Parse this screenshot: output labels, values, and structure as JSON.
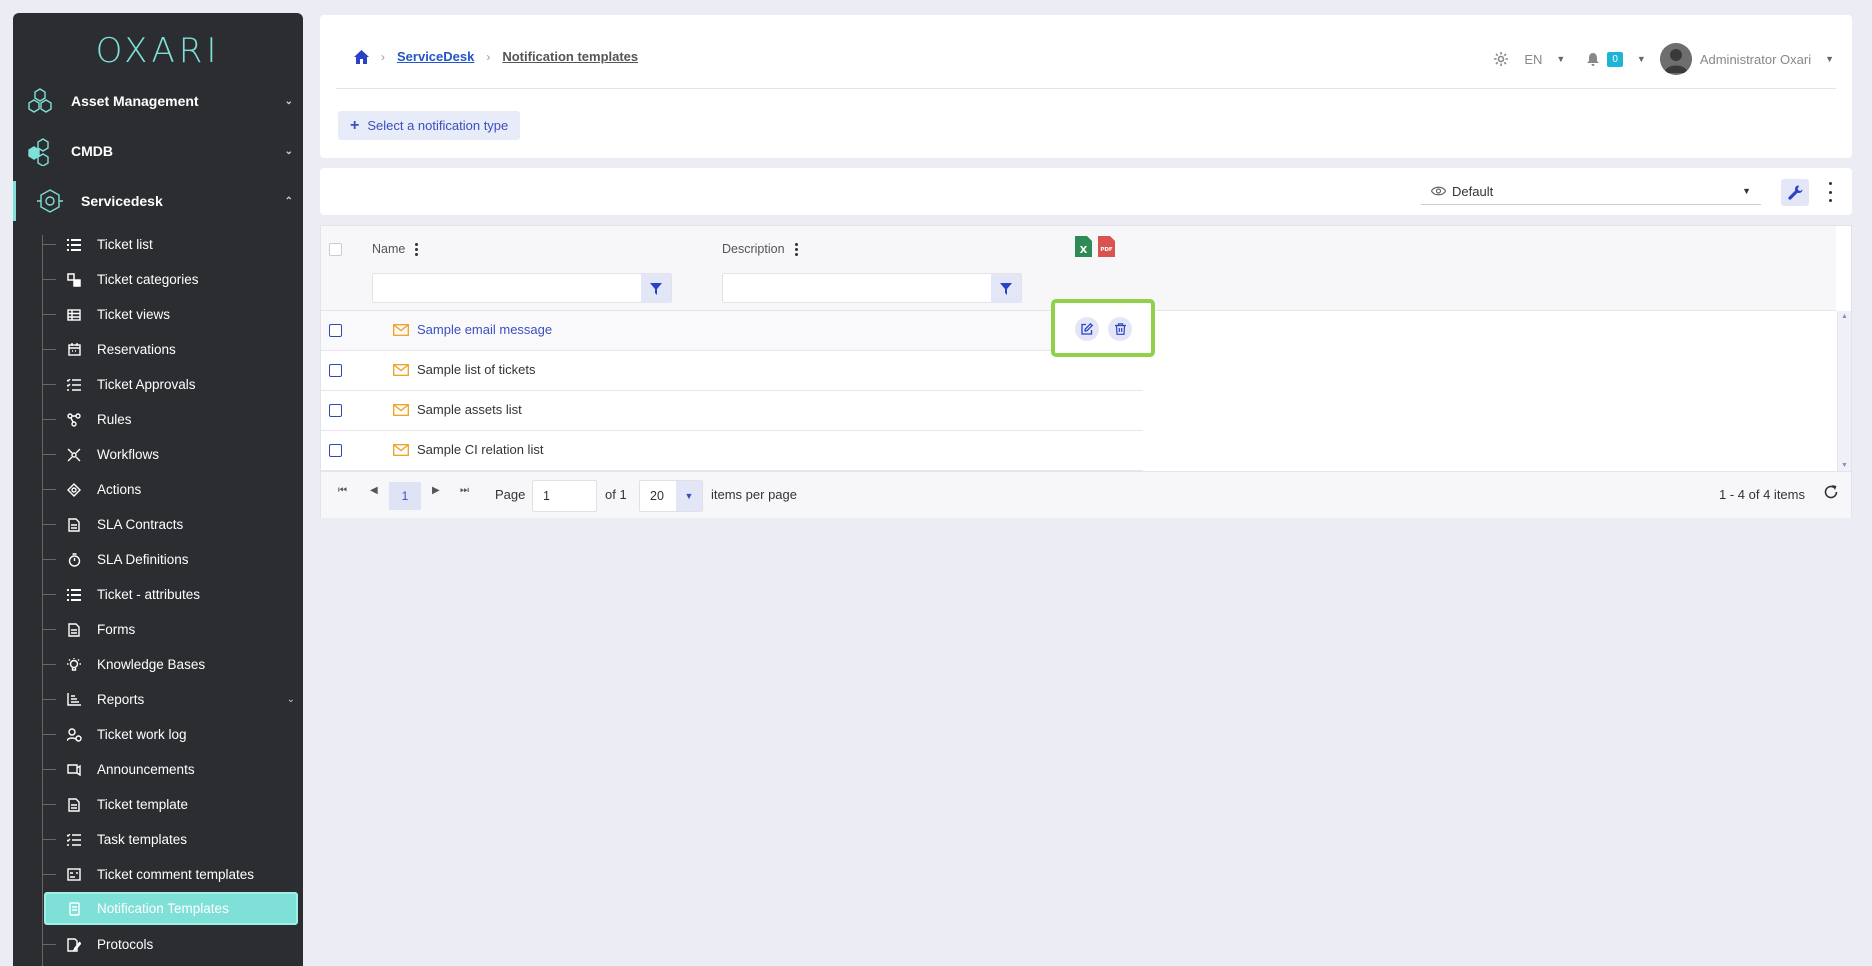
{
  "app": {
    "logo": "OXARI"
  },
  "sidebar": {
    "sections": [
      {
        "label": "Asset Management",
        "icon": "asset-management-icon"
      },
      {
        "label": "CMDB",
        "icon": "cmdb-icon"
      },
      {
        "label": "Servicedesk",
        "icon": "servicedesk-icon"
      }
    ],
    "items": [
      {
        "label": "Ticket list",
        "icon": "list-icon"
      },
      {
        "label": "Ticket categories",
        "icon": "categories-icon"
      },
      {
        "label": "Ticket views",
        "icon": "table-icon"
      },
      {
        "label": "Reservations",
        "icon": "calendar-icon"
      },
      {
        "label": "Ticket Approvals",
        "icon": "checklist-icon"
      },
      {
        "label": "Rules",
        "icon": "rules-icon"
      },
      {
        "label": "Workflows",
        "icon": "workflow-icon"
      },
      {
        "label": "Actions",
        "icon": "actions-icon"
      },
      {
        "label": "SLA Contracts",
        "icon": "document-icon"
      },
      {
        "label": "SLA Definitions",
        "icon": "stopwatch-icon"
      },
      {
        "label": "Ticket - attributes",
        "icon": "list-icon"
      },
      {
        "label": "Forms",
        "icon": "document-icon"
      },
      {
        "label": "Knowledge Bases",
        "icon": "lightbulb-icon"
      },
      {
        "label": "Reports",
        "icon": "chart-icon"
      },
      {
        "label": "Ticket work log",
        "icon": "user-clock-icon"
      },
      {
        "label": "Announcements",
        "icon": "announcement-icon"
      },
      {
        "label": "Ticket template",
        "icon": "document-icon"
      },
      {
        "label": "Task templates",
        "icon": "checklist-icon"
      },
      {
        "label": "Ticket comment templates",
        "icon": "comment-template-icon"
      },
      {
        "label": "Notification Templates",
        "icon": "notification-template-icon"
      },
      {
        "label": "Protocols",
        "icon": "protocol-icon"
      }
    ]
  },
  "header": {
    "breadcrumb": [
      "ServiceDesk",
      "Notification templates"
    ],
    "language": "EN",
    "notifications_count": "0",
    "user_name": "Administrator Oxari",
    "select_button": "Select a notification type"
  },
  "toolbar": {
    "view_name": "Default"
  },
  "grid": {
    "columns": [
      "Name",
      "Description"
    ],
    "rows": [
      {
        "name": "Sample email message"
      },
      {
        "name": "Sample list of tickets"
      },
      {
        "name": "Sample assets list"
      },
      {
        "name": "Sample CI relation list"
      }
    ]
  },
  "pager": {
    "current_page": "1",
    "page_label": "Page",
    "page_input": "1",
    "of_label": "of 1",
    "page_size": "20",
    "items_per_page_label": "items per page",
    "summary": "1 - 4 of 4 items"
  },
  "colors": {
    "accent": "#7fe0d8",
    "primary": "#3a4fc0",
    "highlight": "#8fd24a",
    "sidebar": "#2b2d31"
  }
}
